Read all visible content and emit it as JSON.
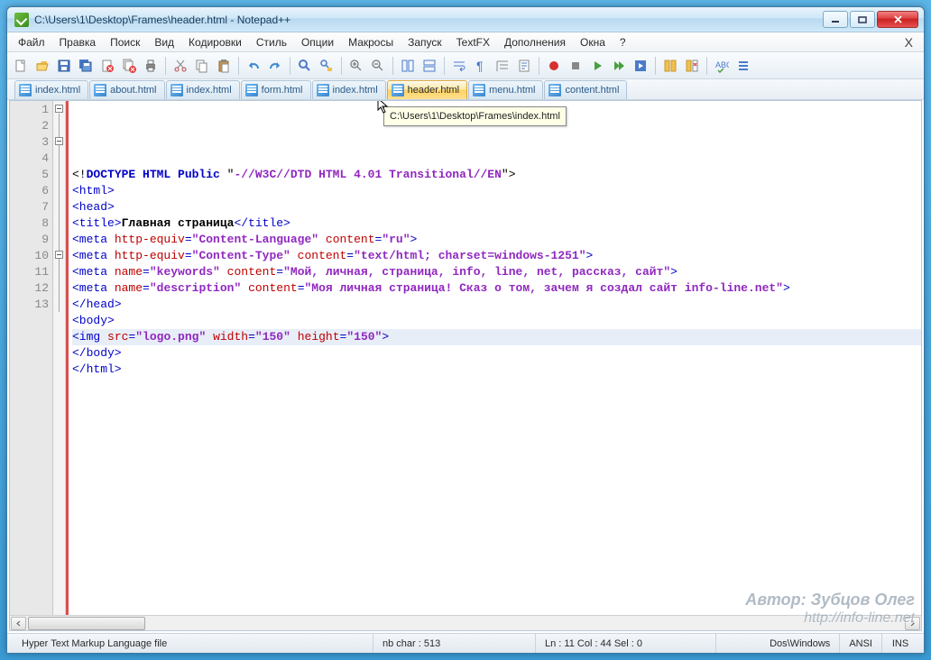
{
  "window": {
    "title": "C:\\Users\\1\\Desktop\\Frames\\header.html - Notepad++"
  },
  "menu": {
    "items": [
      "Файл",
      "Правка",
      "Поиск",
      "Вид",
      "Кодировки",
      "Стиль",
      "Опции",
      "Макросы",
      "Запуск",
      "TextFX",
      "Дополнения",
      "Окна",
      "?"
    ]
  },
  "tabs": [
    {
      "label": "index.html",
      "active": false
    },
    {
      "label": "about.html",
      "active": false
    },
    {
      "label": "index.html",
      "active": false
    },
    {
      "label": "form.html",
      "active": false
    },
    {
      "label": "index.html",
      "active": false
    },
    {
      "label": "header.html",
      "active": true
    },
    {
      "label": "menu.html",
      "active": false
    },
    {
      "label": "content.html",
      "active": false
    }
  ],
  "tooltip": "C:\\Users\\1\\Desktop\\Frames\\index.html",
  "code": {
    "lines": [
      {
        "n": 1,
        "segs": [
          [
            "t-pl",
            "<!"
          ],
          [
            "t-kw",
            "DOCTYPE HTML Public "
          ],
          [
            "t-decl",
            "\""
          ],
          [
            "t-strP",
            "-//W3C//DTD HTML 4.01 Transitional//EN"
          ],
          [
            "t-decl",
            "\""
          ],
          [
            "t-pl",
            ">"
          ]
        ]
      },
      {
        "n": 2,
        "segs": [
          [
            "t-tag",
            "<html>"
          ]
        ]
      },
      {
        "n": 3,
        "segs": [
          [
            "t-tag",
            "<head>"
          ]
        ]
      },
      {
        "n": 4,
        "segs": [
          [
            "t-tag",
            "<title>"
          ],
          [
            "t-txt",
            "Главная страница"
          ],
          [
            "t-tag",
            "</title>"
          ]
        ]
      },
      {
        "n": 5,
        "segs": [
          [
            "t-tag",
            "<meta "
          ],
          [
            "t-attr",
            "http-equiv"
          ],
          [
            "t-tag",
            "="
          ],
          [
            "t-strP",
            "\"Content-Language\""
          ],
          [
            "t-tag",
            " "
          ],
          [
            "t-attr",
            "content"
          ],
          [
            "t-tag",
            "="
          ],
          [
            "t-strP",
            "\"ru\""
          ],
          [
            "t-tag",
            ">"
          ]
        ]
      },
      {
        "n": 6,
        "segs": [
          [
            "t-tag",
            "<meta "
          ],
          [
            "t-attr",
            "http-equiv"
          ],
          [
            "t-tag",
            "="
          ],
          [
            "t-strP",
            "\"Content-Type\""
          ],
          [
            "t-tag",
            " "
          ],
          [
            "t-attr",
            "content"
          ],
          [
            "t-tag",
            "="
          ],
          [
            "t-strP",
            "\"text/html; charset=windows-1251\""
          ],
          [
            "t-tag",
            ">"
          ]
        ]
      },
      {
        "n": 7,
        "segs": [
          [
            "t-tag",
            "<meta "
          ],
          [
            "t-attr",
            "name"
          ],
          [
            "t-tag",
            "="
          ],
          [
            "t-strP",
            "\"keywords\""
          ],
          [
            "t-tag",
            " "
          ],
          [
            "t-attr",
            "content"
          ],
          [
            "t-tag",
            "="
          ],
          [
            "t-strP",
            "\"Мой, личная, страница, info, line, net, рассказ, сайт\""
          ],
          [
            "t-tag",
            ">"
          ]
        ]
      },
      {
        "n": 8,
        "segs": [
          [
            "t-tag",
            "<meta "
          ],
          [
            "t-attr",
            "name"
          ],
          [
            "t-tag",
            "="
          ],
          [
            "t-strP",
            "\"description\""
          ],
          [
            "t-tag",
            " "
          ],
          [
            "t-attr",
            "content"
          ],
          [
            "t-tag",
            "="
          ],
          [
            "t-strP",
            "\"Моя личная страница! Сказ о том, зачем я создал сайт info-line.net\""
          ],
          [
            "t-tag",
            ">"
          ]
        ]
      },
      {
        "n": 9,
        "segs": [
          [
            "t-tag",
            "</head>"
          ]
        ]
      },
      {
        "n": 10,
        "segs": [
          [
            "t-tag",
            "<body>"
          ]
        ]
      },
      {
        "n": 11,
        "hl": true,
        "segs": [
          [
            "t-tag",
            "<img "
          ],
          [
            "t-attr",
            "src"
          ],
          [
            "t-tag",
            "="
          ],
          [
            "t-strP",
            "\"logo.png\""
          ],
          [
            "t-tag",
            " "
          ],
          [
            "t-attr",
            "width"
          ],
          [
            "t-tag",
            "="
          ],
          [
            "t-strP",
            "\"150\""
          ],
          [
            "t-tag",
            " "
          ],
          [
            "t-attr",
            "height"
          ],
          [
            "t-tag",
            "="
          ],
          [
            "t-strP",
            "\"150\""
          ],
          [
            "t-tag",
            ">"
          ]
        ]
      },
      {
        "n": 12,
        "segs": [
          [
            "t-tag",
            "</body>"
          ]
        ]
      },
      {
        "n": 13,
        "segs": [
          [
            "t-tag",
            "</html>"
          ]
        ]
      }
    ]
  },
  "statusbar": {
    "filetype": "Hyper Text Markup Language file",
    "nbchar": "nb char : 513",
    "pos": "Ln : 11   Col : 44   Sel : 0",
    "eol": "Dos\\Windows",
    "enc": "ANSI",
    "ins": "INS"
  },
  "watermark": {
    "l1": "Автор: Зубцов Олег",
    "l2": "http://info-line.net"
  }
}
